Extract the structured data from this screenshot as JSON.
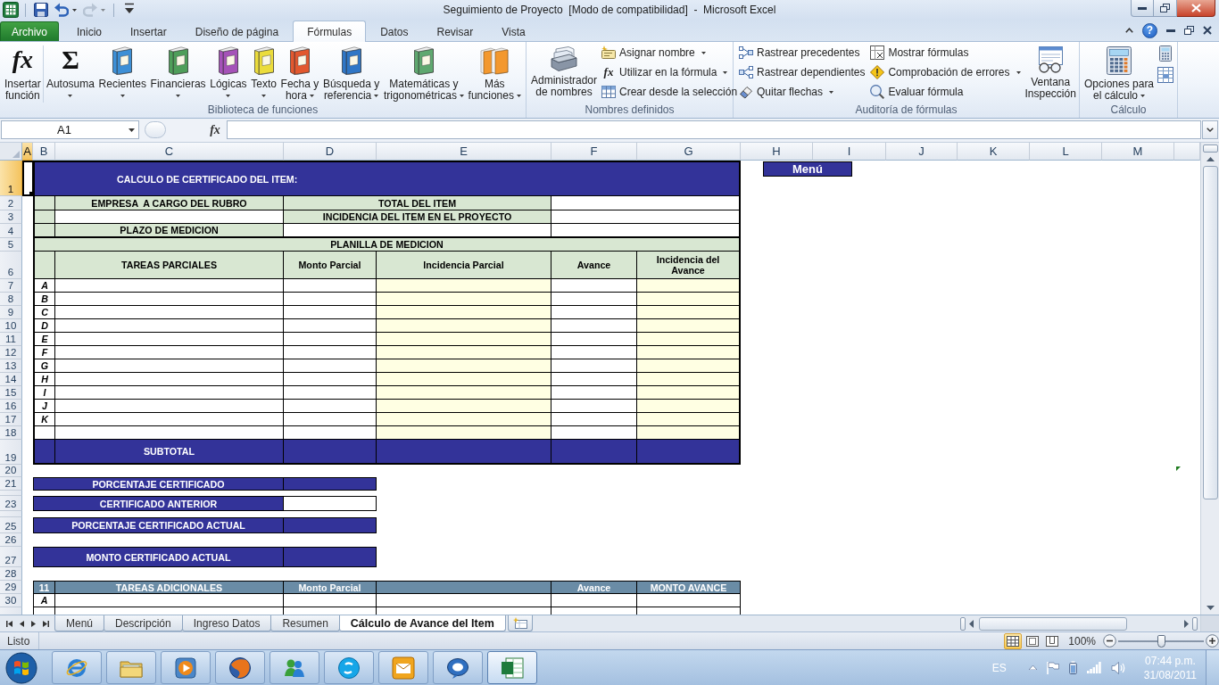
{
  "window": {
    "title": "Seguimiento de Proyecto  [Modo de compatibilidad]  -  Microsoft Excel"
  },
  "quick_access": [
    {
      "kind": "save",
      "dropdown": false,
      "disabled": false
    },
    {
      "kind": "undo",
      "dropdown": true,
      "disabled": false
    },
    {
      "kind": "redo",
      "dropdown": true,
      "disabled": true
    },
    {
      "kind": "customize",
      "dropdown": false,
      "disabled": false
    }
  ],
  "ribbon_tabs": [
    {
      "label": "Archivo",
      "kind": "file",
      "selected": false
    },
    {
      "label": "Inicio",
      "kind": "tab",
      "selected": false
    },
    {
      "label": "Insertar",
      "kind": "tab",
      "selected": false
    },
    {
      "label": "Diseño de página",
      "kind": "tab",
      "selected": false
    },
    {
      "label": "Fórmulas",
      "kind": "tab",
      "selected": true
    },
    {
      "label": "Datos",
      "kind": "tab",
      "selected": false
    },
    {
      "label": "Revisar",
      "kind": "tab",
      "selected": false
    },
    {
      "label": "Vista",
      "kind": "tab",
      "selected": false
    }
  ],
  "help_button": {
    "glyph": "?"
  },
  "ribbon_groups": [
    {
      "label": "Biblioteca de funciones",
      "items": [
        {
          "kind": "function",
          "glyph": "fx",
          "label": "Insertar\nfunción",
          "dropdown": false
        },
        {
          "kind": "divider"
        },
        {
          "kind": "sum",
          "glyph": "Σ",
          "label": "Autosuma",
          "dropdown": true
        },
        {
          "kind": "book",
          "color": "#3d8fd6",
          "label": "Recientes",
          "dropdown": true
        },
        {
          "kind": "book",
          "color": "#4f9e5a",
          "label": "Financieras",
          "dropdown": true
        },
        {
          "kind": "book",
          "color": "#a552b8",
          "label": "Lógicas",
          "dropdown": true
        },
        {
          "kind": "book",
          "color": "#ebdc3c",
          "label": "Texto",
          "dropdown": true
        },
        {
          "kind": "book",
          "color": "#e2582e",
          "label": "Fecha y\nhora",
          "dropdown": true
        },
        {
          "kind": "book",
          "color": "#2f76c6",
          "label": "Búsqueda y\nreferencia",
          "dropdown": true
        },
        {
          "kind": "book",
          "color": "#5fa870",
          "label": "Matemáticas y\ntrigonométricas",
          "dropdown": true
        },
        {
          "kind": "books",
          "color": "#f3982e",
          "label": "Más\nfunciones",
          "dropdown": true
        }
      ]
    },
    {
      "label": "Nombres definidos",
      "items": [
        {
          "kind": "names",
          "label": "Administrador\nde nombres",
          "dropdown": false
        },
        {
          "kind": "stack",
          "buttons": [
            {
              "kind": "tag",
              "label": "Asignar nombre",
              "dropdown": true
            },
            {
              "kind": "function",
              "glyph": "fx",
              "label": "Utilizar en la fórmula",
              "dropdown": true
            },
            {
              "kind": "table",
              "label": "Crear desde la selección",
              "dropdown": false
            }
          ]
        }
      ]
    },
    {
      "label": "Auditoría de fórmulas",
      "items": [
        {
          "kind": "stack",
          "buttons": [
            {
              "kind": "precedents",
              "label": "Rastrear precedentes",
              "dropdown": false
            },
            {
              "kind": "dependents",
              "label": "Rastrear dependientes",
              "dropdown": false
            },
            {
              "kind": "eraser",
              "label": "Quitar flechas",
              "dropdown": true
            }
          ]
        },
        {
          "kind": "stack",
          "buttons": [
            {
              "kind": "formulas",
              "label": "Mostrar fórmulas",
              "dropdown": false
            },
            {
              "kind": "errors",
              "label": "Comprobación de errores",
              "dropdown": true
            },
            {
              "kind": "evaluate",
              "label": "Evaluar fórmula",
              "dropdown": false
            }
          ]
        },
        {
          "kind": "watch",
          "label": "Ventana\nInspección",
          "dropdown": false
        }
      ]
    },
    {
      "label": "Cálculo",
      "items": [
        {
          "kind": "calculator",
          "label": "Opciones para\nel cálculo",
          "dropdown": true
        },
        {
          "kind": "stack",
          "buttons": [
            {
              "kind": "calculator",
              "dropdown": false
            },
            {
              "kind": "sheet",
              "dropdown": false
            }
          ]
        }
      ]
    }
  ],
  "formula_bar": {
    "name_box": "A1",
    "function_glyph": "fx"
  },
  "sheet": {
    "columns": [
      {
        "label": "A",
        "selected": true
      },
      {
        "label": "B",
        "selected": false
      },
      {
        "label": "C",
        "selected": false
      },
      {
        "label": "D",
        "selected": false
      },
      {
        "label": "E",
        "selected": false
      },
      {
        "label": "F",
        "selected": false
      },
      {
        "label": "G",
        "selected": false
      },
      {
        "label": "H",
        "selected": false
      },
      {
        "label": "I",
        "selected": false
      },
      {
        "label": "J",
        "selected": false
      },
      {
        "label": "K",
        "selected": false
      },
      {
        "label": "L",
        "selected": false
      },
      {
        "label": "M",
        "selected": false
      }
    ],
    "rows": [
      {
        "label": "1",
        "selected": true
      },
      {
        "label": "2",
        "selected": false
      },
      {
        "label": "3",
        "selected": false
      },
      {
        "label": "4",
        "selected": false
      },
      {
        "label": "5",
        "selected": false
      },
      {
        "label": "6",
        "selected": false
      },
      {
        "label": "7",
        "selected": false
      },
      {
        "label": "8",
        "selected": false
      },
      {
        "label": "9",
        "selected": false
      },
      {
        "label": "10",
        "selected": false
      },
      {
        "label": "11",
        "selected": false
      },
      {
        "label": "12",
        "selected": false
      },
      {
        "label": "13",
        "selected": false
      },
      {
        "label": "14",
        "selected": false
      },
      {
        "label": "15",
        "selected": false
      },
      {
        "label": "16",
        "selected": false
      },
      {
        "label": "17",
        "selected": false
      },
      {
        "label": "18",
        "selected": false
      },
      {
        "label": "19",
        "selected": false
      },
      {
        "label": "20",
        "selected": false
      },
      {
        "label": "21",
        "selected": false
      },
      {
        "selected": false
      },
      {
        "label": "23",
        "selected": false
      },
      {
        "selected": false
      },
      {
        "label": "25",
        "selected": false
      },
      {
        "label": "26",
        "selected": false
      },
      {
        "label": "27",
        "selected": false
      },
      {
        "label": "28",
        "selected": false
      },
      {
        "label": "29",
        "selected": false
      },
      {
        "label": "30",
        "selected": false
      },
      {
        "selected": false
      }
    ],
    "title": "CALCULO DE CERTIFICADO DEL ITEM:",
    "menu_button": "Menú",
    "info": {
      "company_label": "EMPRESA  A CARGO DEL RUBRO",
      "total_label": "TOTAL DEL ITEM",
      "incidence_label": "INCIDENCIA DEL ITEM EN EL PROYECTO",
      "term_label": "PLAZO DE MEDICION"
    },
    "measurement": {
      "title": "PLANILLA DE MEDICION",
      "columns": [
        {
          "label": "TAREAS PARCIALES",
          "shaded": false
        },
        {
          "label": "Monto Parcial",
          "shaded": false
        },
        {
          "label": "Incidencia Parcial",
          "shaded": true
        },
        {
          "label": "Avance",
          "shaded": false
        },
        {
          "label": "Incidencia del Avance",
          "shaded": true
        }
      ],
      "tasks": [
        {
          "kind": "task",
          "label": "A"
        },
        {
          "kind": "task",
          "label": "B"
        },
        {
          "kind": "task",
          "label": "C"
        },
        {
          "kind": "task",
          "label": "D"
        },
        {
          "kind": "task",
          "label": "E"
        },
        {
          "kind": "task",
          "label": "F"
        },
        {
          "kind": "task",
          "label": "G"
        },
        {
          "kind": "task",
          "label": "H"
        },
        {
          "kind": "task",
          "label": "I"
        },
        {
          "kind": "task",
          "label": "J"
        },
        {
          "kind": "task",
          "label": "K"
        },
        {
          "kind": "blank"
        }
      ],
      "subtotal": "SUBTOTAL"
    },
    "summary": [
      {
        "label": "PORCENTAJE CERTIFICADO",
        "editable": false
      },
      {
        "label": "CERTIFICADO ANTERIOR",
        "editable": true
      },
      {
        "label": "PORCENTAJE CERTIFICADO ACTUAL",
        "editable": false
      },
      {
        "label": "MONTO CERTIFICADO ACTUAL",
        "editable": false
      }
    ],
    "additional": {
      "number": "11",
      "columns": [
        {
          "kind": "heading",
          "label": "TAREAS ADICIONALES"
        },
        {
          "kind": "heading",
          "label": "Monto Parcial"
        },
        {
          "kind": "blank"
        },
        {
          "kind": "heading",
          "label": "Avance"
        },
        {
          "kind": "heading",
          "label": "MONTO AVANCE"
        }
      ],
      "tasks": [
        {
          "kind": "task",
          "label": "A"
        },
        {
          "kind": "blank"
        }
      ]
    }
  },
  "sheet_tabs": [
    {
      "label": "Menú",
      "selected": false
    },
    {
      "label": "Descripción",
      "selected": false
    },
    {
      "label": "Ingreso Datos",
      "selected": false
    },
    {
      "label": "Resumen",
      "selected": false
    },
    {
      "label": "Cálculo de Avance del Item",
      "selected": true
    }
  ],
  "status_bar": {
    "text": "Listo",
    "views": [
      {
        "kind": "normal",
        "selected": true
      },
      {
        "kind": "layout",
        "selected": false
      },
      {
        "kind": "breaks",
        "selected": false
      }
    ],
    "zoom": "100%",
    "zoom_slider": {
      "level": 0.5
    }
  },
  "taskbar": {
    "apps": [
      {
        "kind": "browser",
        "selected": false
      },
      {
        "kind": "files",
        "selected": false
      },
      {
        "kind": "media",
        "selected": false
      },
      {
        "kind": "globe",
        "selected": false
      },
      {
        "kind": "people",
        "selected": false
      },
      {
        "kind": "chat",
        "selected": false
      },
      {
        "kind": "mail",
        "selected": false
      },
      {
        "kind": "player",
        "selected": false
      },
      {
        "kind": "spreadsheet",
        "selected": true
      }
    ],
    "language": "ES",
    "time": "07:44 p.m.",
    "date": "31/08/2011"
  }
}
